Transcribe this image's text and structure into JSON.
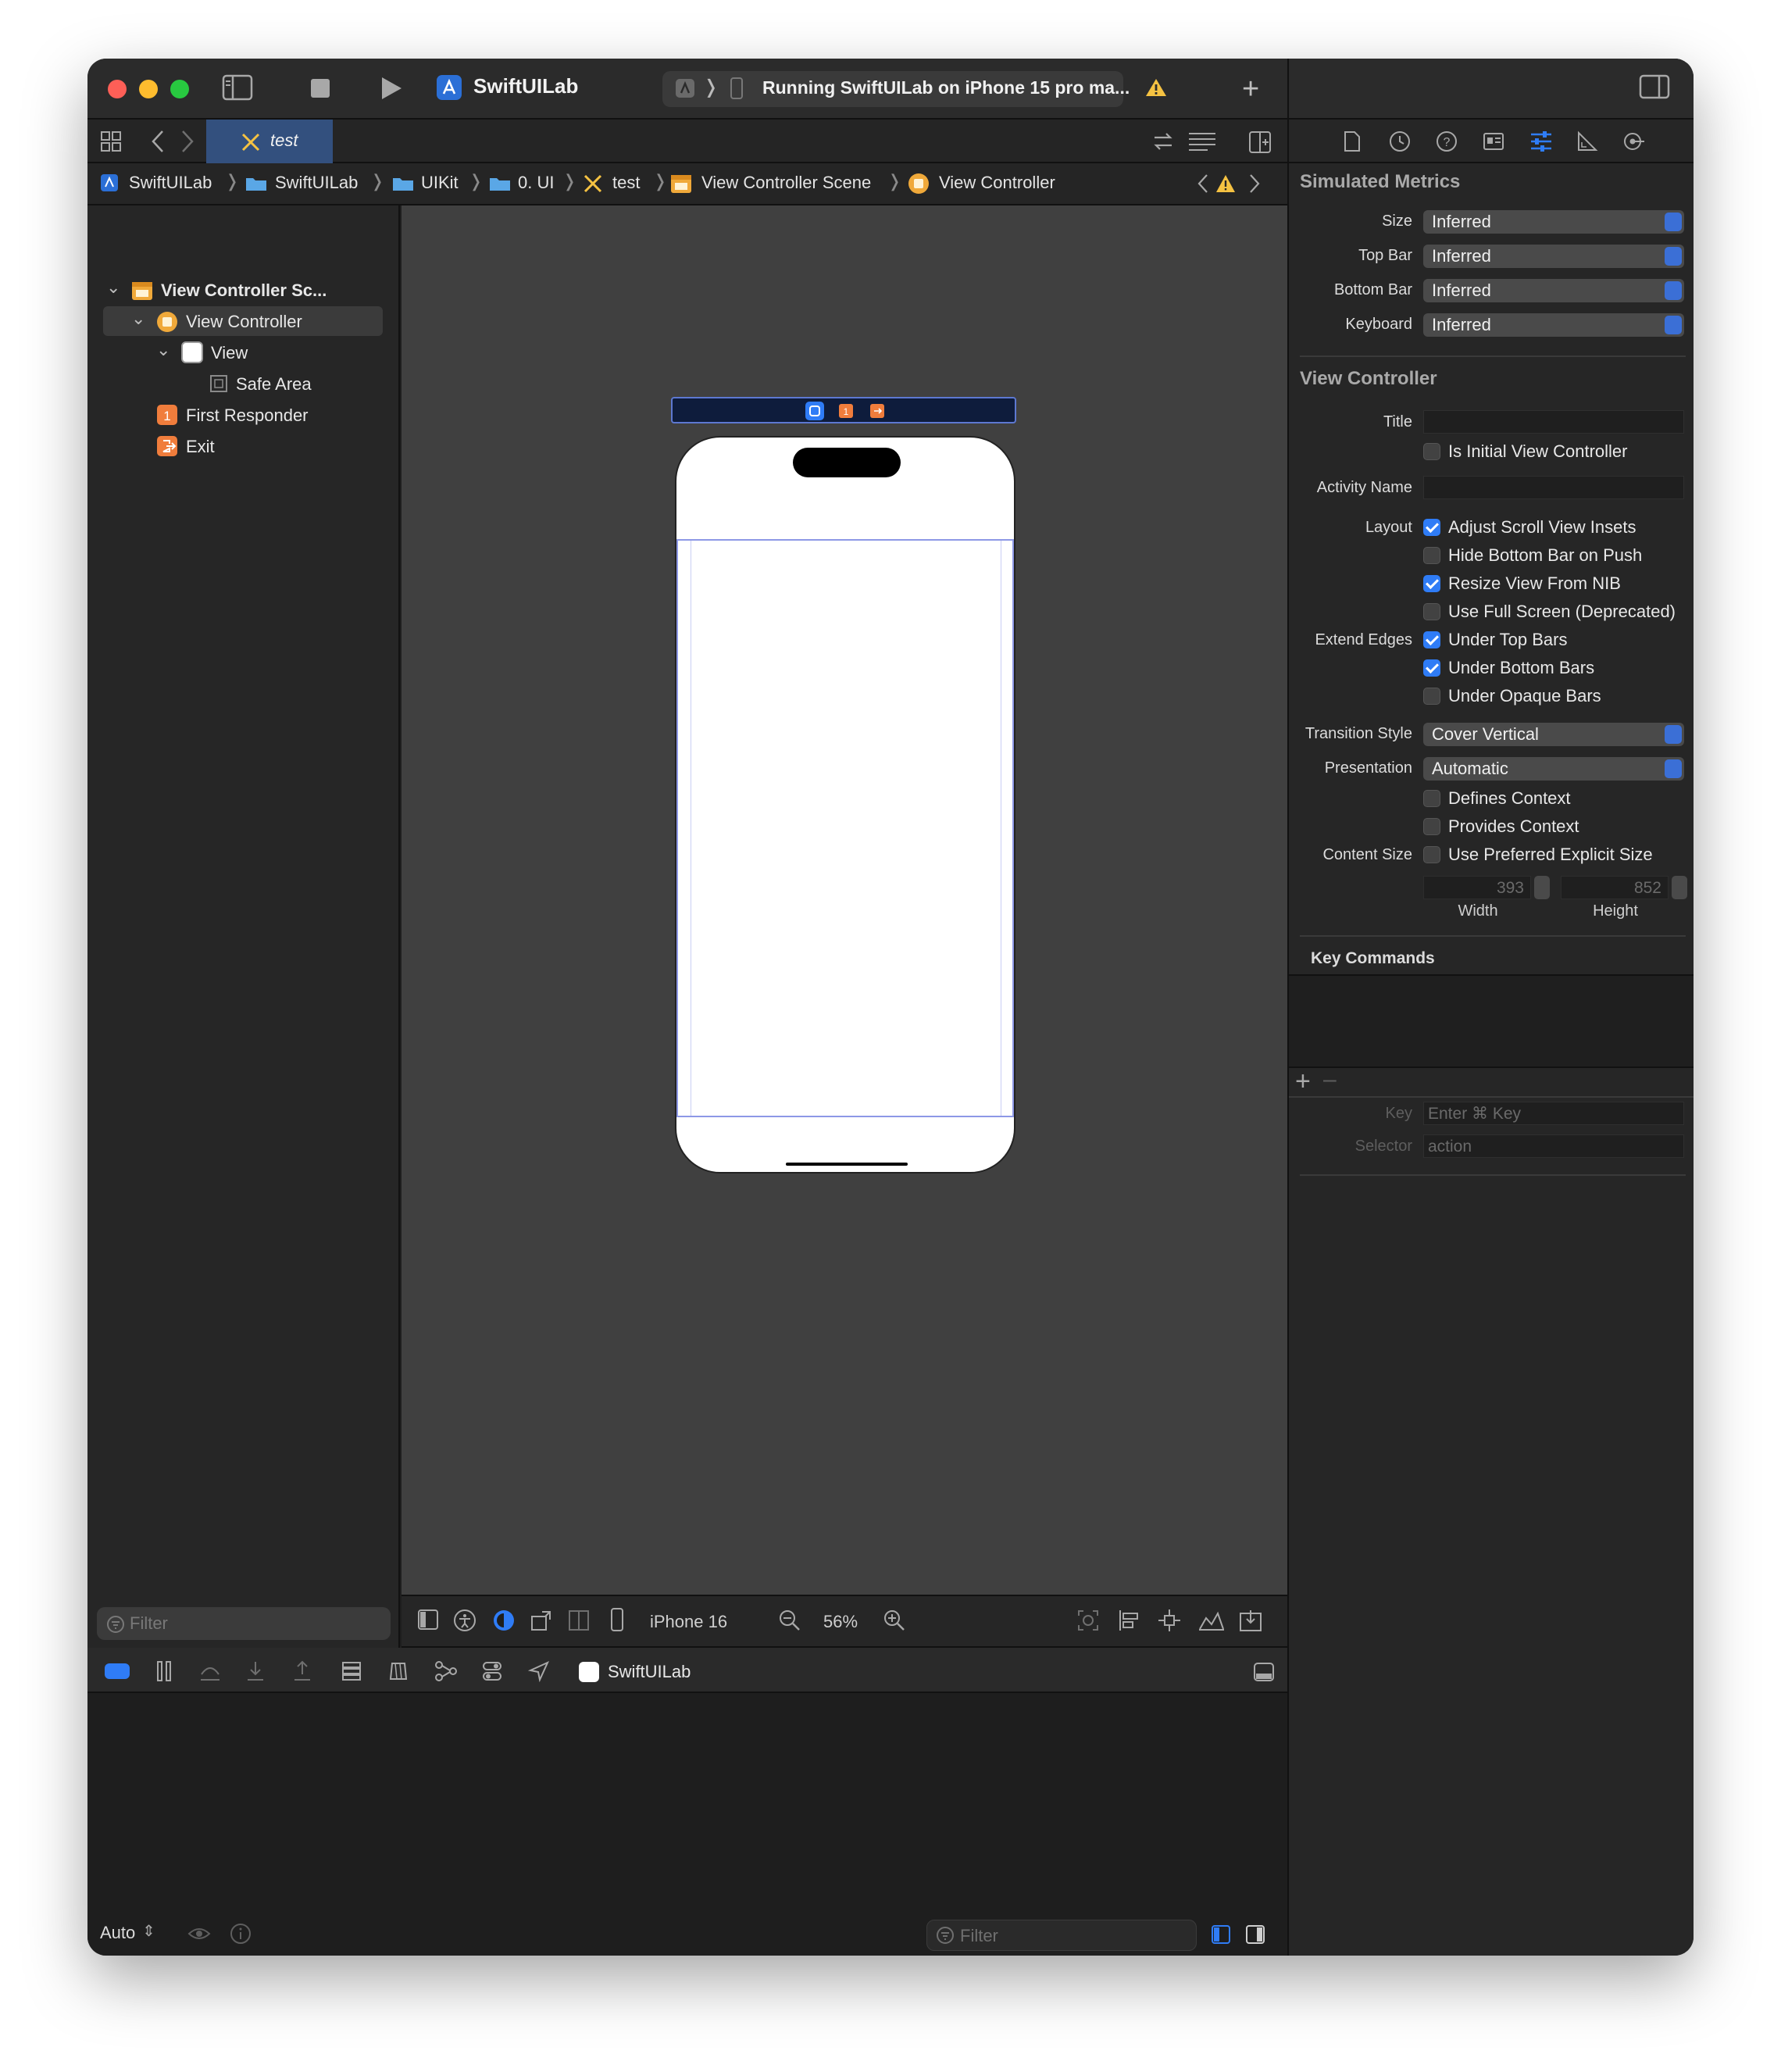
{
  "window": {
    "app_title": "SwiftUILab",
    "run_status": "Running SwiftUILab on iPhone 15 pro ma..."
  },
  "tab": {
    "active_label": "test"
  },
  "breadcrumbs": [
    "SwiftUILab",
    "SwiftUILab",
    "UIKit",
    "0. UI",
    "test",
    "View Controller Scene",
    "View Controller"
  ],
  "navigator": {
    "items": [
      {
        "label": "View Controller Sc...",
        "level": 0
      },
      {
        "label": "View Controller",
        "level": 1
      },
      {
        "label": "View",
        "level": 2
      },
      {
        "label": "Safe Area",
        "level": 3
      },
      {
        "label": "First Responder",
        "level": 1
      },
      {
        "label": "Exit",
        "level": 1
      }
    ],
    "filter_placeholder": "Filter"
  },
  "canvas": {
    "device": "iPhone 16",
    "zoom": "56%"
  },
  "debug": {
    "target": "SwiftUILab",
    "mode": "Auto",
    "filter_placeholder": "Filter"
  },
  "inspector": {
    "simulated_metrics": {
      "title": "Simulated Metrics",
      "rows": [
        {
          "label": "Size",
          "value": "Inferred"
        },
        {
          "label": "Top Bar",
          "value": "Inferred"
        },
        {
          "label": "Bottom Bar",
          "value": "Inferred"
        },
        {
          "label": "Keyboard",
          "value": "Inferred"
        }
      ]
    },
    "view_controller": {
      "title": "View Controller",
      "title_label": "Title",
      "is_initial": "Is Initial View Controller",
      "activity_label": "Activity Name",
      "layout_label": "Layout",
      "layout_options": [
        {
          "label": "Adjust Scroll View Insets",
          "checked": true
        },
        {
          "label": "Hide Bottom Bar on Push",
          "checked": false
        },
        {
          "label": "Resize View From NIB",
          "checked": true
        },
        {
          "label": "Use Full Screen (Deprecated)",
          "checked": false
        }
      ],
      "extend_label": "Extend Edges",
      "extend_options": [
        {
          "label": "Under Top Bars",
          "checked": true
        },
        {
          "label": "Under Bottom Bars",
          "checked": true
        },
        {
          "label": "Under Opaque Bars",
          "checked": false
        }
      ],
      "transition_label": "Transition Style",
      "transition_value": "Cover Vertical",
      "presentation_label": "Presentation",
      "presentation_value": "Automatic",
      "defines_context": "Defines Context",
      "provides_context": "Provides Context",
      "content_size_label": "Content Size",
      "use_preferred": "Use Preferred Explicit Size",
      "width_value": "393",
      "height_value": "852",
      "width_label": "Width",
      "height_label": "Height"
    },
    "key_commands": {
      "title": "Key Commands",
      "key_label": "Key",
      "key_placeholder": "Enter ⌘ Key",
      "selector_label": "Selector",
      "selector_placeholder": "action"
    }
  }
}
